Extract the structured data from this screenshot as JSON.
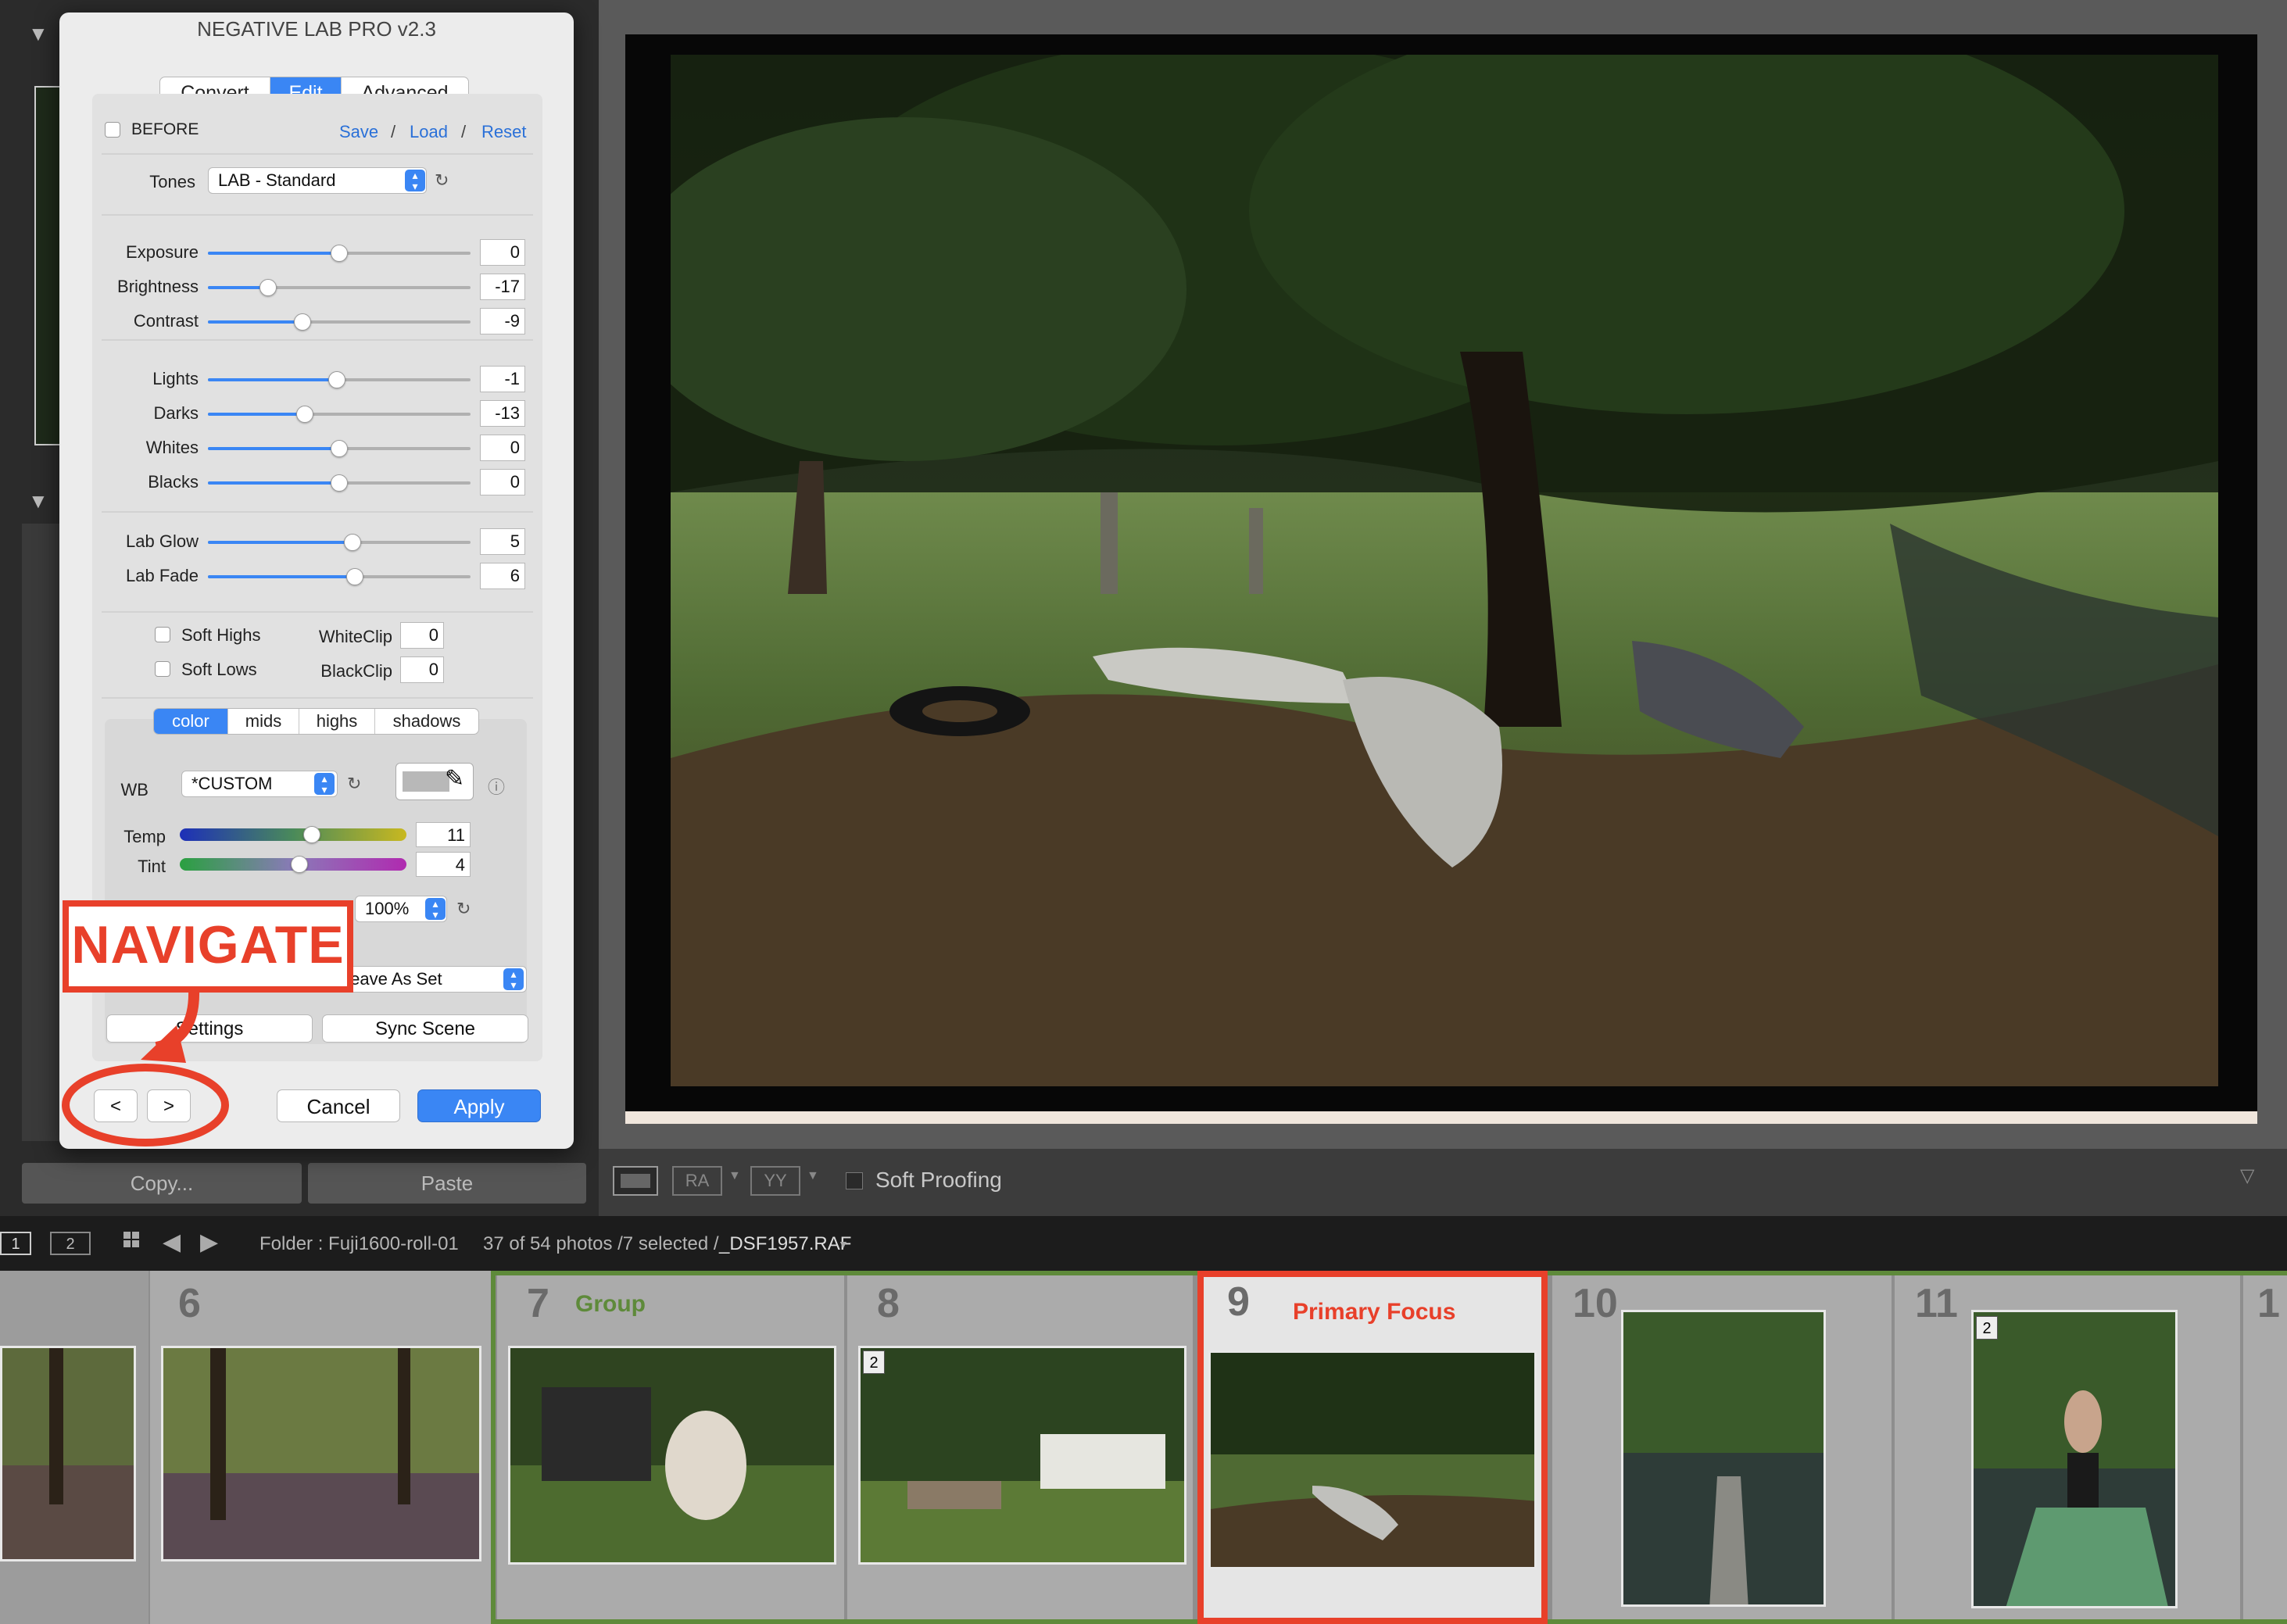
{
  "dialog": {
    "title": "NEGATIVE LAB PRO v2.3",
    "tabs": [
      "Convert",
      "Edit",
      "Advanced"
    ],
    "active_tab": "Edit",
    "before_label": "BEFORE",
    "save_label": "Save",
    "load_label": "Load",
    "reset_label": "Reset",
    "slash": "/",
    "tones_label": "Tones",
    "tones_value": "LAB - Standard",
    "sliders_a": [
      {
        "label": "Exposure",
        "value": "0",
        "pos": 0.5
      },
      {
        "label": "Brightness",
        "value": "-17",
        "pos": 0.23
      },
      {
        "label": "Contrast",
        "value": "-9",
        "pos": 0.36
      }
    ],
    "sliders_b": [
      {
        "label": "Lights",
        "value": "-1",
        "pos": 0.49
      },
      {
        "label": "Darks",
        "value": "-13",
        "pos": 0.37
      },
      {
        "label": "Whites",
        "value": "0",
        "pos": 0.5
      },
      {
        "label": "Blacks",
        "value": "0",
        "pos": 0.5
      }
    ],
    "sliders_c": [
      {
        "label": "Lab Glow",
        "value": "5",
        "pos": 0.55
      },
      {
        "label": "Lab Fade",
        "value": "6",
        "pos": 0.56
      }
    ],
    "soft_highs_label": "Soft Highs",
    "soft_lows_label": "Soft Lows",
    "whiteclip_label": "WhiteClip",
    "whiteclip_value": "0",
    "blackclip_label": "BlackClip",
    "blackclip_value": "0",
    "subtabs": [
      "color",
      "mids",
      "highs",
      "shadows"
    ],
    "active_subtab": "color",
    "wb_label": "WB",
    "wb_value": "*CUSTOM",
    "temp_label": "Temp",
    "temp_value": "11",
    "tint_label": "Tint",
    "tint_value": "4",
    "sat_value": "100%",
    "sharpen_value": "pen: Leave As Set",
    "settings_button": "Settings",
    "sync_scene_button": "Sync Scene",
    "prev_button": "<",
    "next_button": ">",
    "cancel_button": "Cancel",
    "apply_button": "Apply"
  },
  "annotation": {
    "navigate_label": "NAVIGATE",
    "color": "#e8402a"
  },
  "panel": {
    "copy_button": "Copy...",
    "paste_button": "Paste"
  },
  "toolbar": {
    "soft_proofing_label": "Soft Proofing"
  },
  "stripbar": {
    "view1": "1",
    "view2": "2",
    "folder_text": "Folder : Fuji1600-roll-01",
    "count_text": "37 of 54 photos /7 selected /",
    "filename": "_DSF1957.RAF"
  },
  "filmstrip": {
    "cells": [
      {
        "num": "6",
        "label": ""
      },
      {
        "num": "7",
        "label": "Group"
      },
      {
        "num": "8",
        "label": ""
      },
      {
        "num": "9",
        "label": "Primary Focus"
      },
      {
        "num": "10",
        "label": ""
      },
      {
        "num": "11",
        "label": ""
      }
    ],
    "stack_badge": "2",
    "group_color": "#5e8a3a",
    "primary_color": "#e8402a"
  },
  "colors": {
    "accent": "#3a86f4"
  }
}
